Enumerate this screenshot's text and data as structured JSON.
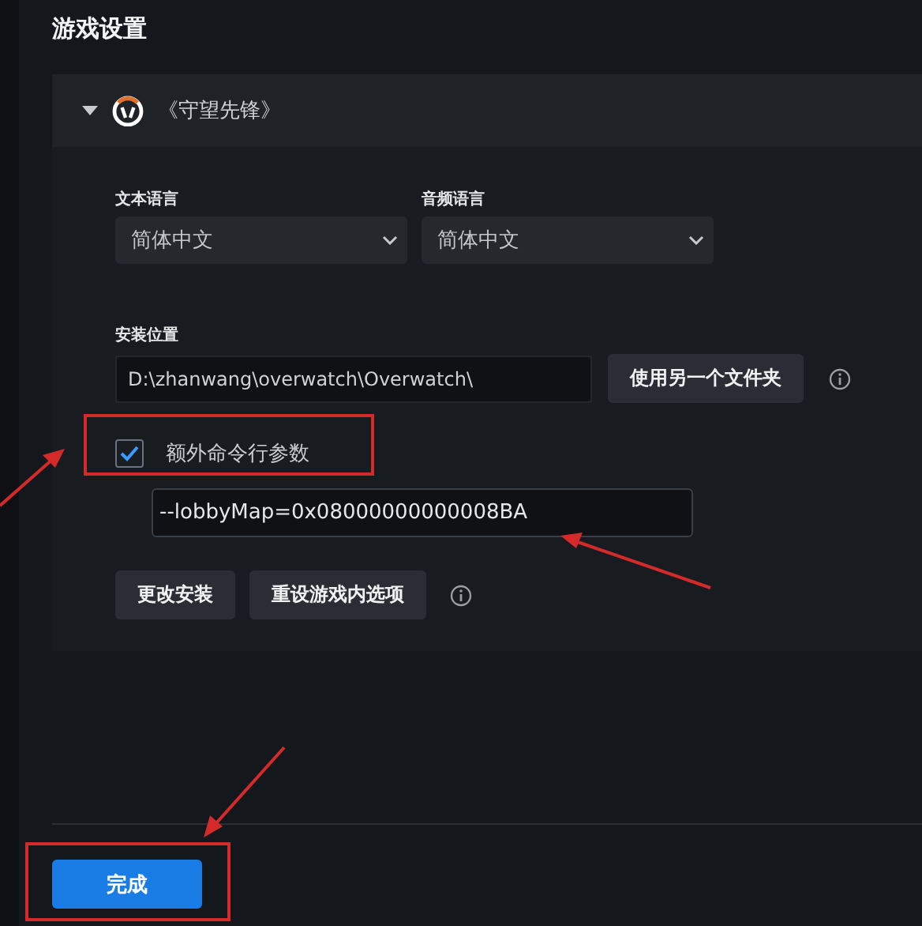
{
  "title": "游戏设置",
  "game": {
    "name": "《守望先锋》",
    "expanded": true
  },
  "languages": [
    {
      "label": "文本语言",
      "value": "简体中文"
    },
    {
      "label": "音频语言",
      "value": "简体中文"
    }
  ],
  "install": {
    "label": "安装位置",
    "path": "D:\\zhanwang\\overwatch\\Overwatch\\",
    "button": "使用另一个文件夹"
  },
  "extra_args": {
    "label": "额外命令行参数",
    "checked": true,
    "value": "--lobbyMap=0x08000000000008BA"
  },
  "actions": [
    "更改安装",
    "重设游戏内选项"
  ],
  "done_button": "完成"
}
